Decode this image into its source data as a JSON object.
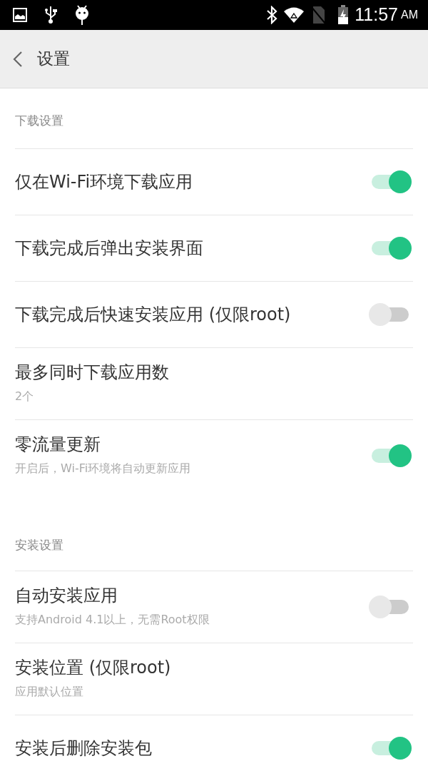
{
  "status_bar": {
    "time": "11:57",
    "meridiem": "AM"
  },
  "app_bar": {
    "title": "设置"
  },
  "sections": [
    {
      "title": "下载设置",
      "items": [
        {
          "kind": "switch",
          "title": "仅在Wi-Fi环境下载应用",
          "on": true
        },
        {
          "kind": "switch",
          "title": "下载完成后弹出安装界面",
          "on": true
        },
        {
          "kind": "switch",
          "title": "下载完成后快速安装应用 (仅限root)",
          "on": false
        },
        {
          "kind": "value",
          "title": "最多同时下载应用数",
          "subtitle": "2个"
        },
        {
          "kind": "switch",
          "title": "零流量更新",
          "subtitle": "开启后，Wi-Fi环境将自动更新应用",
          "on": true
        }
      ]
    },
    {
      "title": "安装设置",
      "items": [
        {
          "kind": "switch",
          "title": "自动安装应用",
          "subtitle": "支持Android 4.1以上，无需Root权限",
          "on": false
        },
        {
          "kind": "value",
          "title": "安装位置 (仅限root)",
          "subtitle": "应用默认位置"
        },
        {
          "kind": "switch",
          "title": "安装后删除安装包",
          "on": true
        }
      ]
    }
  ]
}
